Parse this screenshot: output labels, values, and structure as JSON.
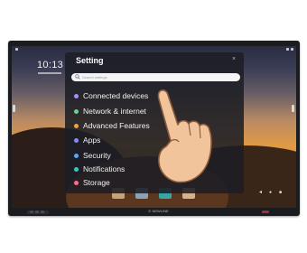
{
  "screen": {
    "clock": "10:13"
  },
  "settings": {
    "title": "Setting",
    "search_placeholder": "Search settings",
    "items": [
      {
        "label": "Connected devices",
        "color": "#a98cff"
      },
      {
        "label": "Network & internet",
        "color": "#6fd08c"
      },
      {
        "label": "Advanced Features",
        "color": "#f0a342"
      },
      {
        "label": "Apps",
        "color": "#7f8cff"
      },
      {
        "label": "Security",
        "color": "#5aa7ff"
      },
      {
        "label": "Notifications",
        "color": "#37c7c9"
      },
      {
        "label": "Storage",
        "color": "#ff6b8a"
      }
    ]
  },
  "icons": [
    "search-icon",
    "close-icon",
    "hand-pointer-icon",
    "back-arrow-icon",
    "home-icon",
    "recent-apps-icon"
  ],
  "nav": {
    "back": "◂",
    "home": "●",
    "recent": "■"
  },
  "brand": "⊙ NEWLINE"
}
